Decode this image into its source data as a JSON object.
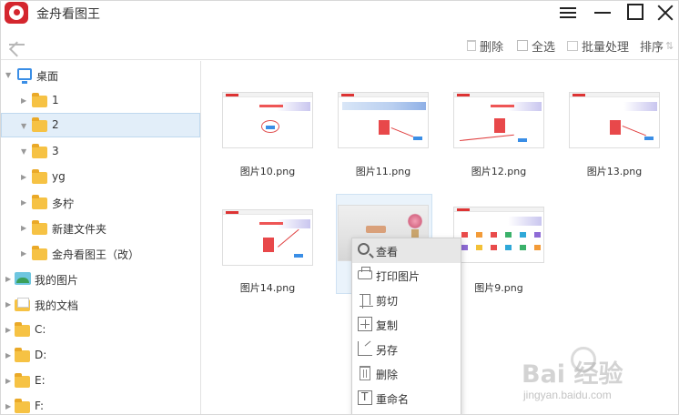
{
  "app": {
    "title": "金舟看图王"
  },
  "toolbar": {
    "delete_label": "删除",
    "select_all_label": "全选",
    "batch_label": "批量处理",
    "sort_label": "排序"
  },
  "sidebar": {
    "items": [
      {
        "label": "桌面",
        "icon": "desktop-icon"
      },
      {
        "label": "1",
        "icon": "folder-icon"
      },
      {
        "label": "2",
        "icon": "folder-icon",
        "selected": true
      },
      {
        "label": "3",
        "icon": "folder-icon"
      },
      {
        "label": "yg",
        "icon": "folder-icon"
      },
      {
        "label": "多柠",
        "icon": "folder-icon"
      },
      {
        "label": "新建文件夹",
        "icon": "folder-icon"
      },
      {
        "label": "金舟看图王（改）",
        "icon": "folder-icon"
      },
      {
        "label": "我的图片",
        "icon": "pictures-icon"
      },
      {
        "label": "我的文档",
        "icon": "documents-icon"
      },
      {
        "label": "C:",
        "icon": "drive-icon"
      },
      {
        "label": "D:",
        "icon": "drive-icon"
      },
      {
        "label": "E:",
        "icon": "drive-icon"
      },
      {
        "label": "F:",
        "icon": "drive-icon"
      }
    ]
  },
  "files": [
    {
      "name": "图片10.png"
    },
    {
      "name": "图片11.png"
    },
    {
      "name": "图片12.png"
    },
    {
      "name": "图片13.png"
    },
    {
      "name": "图片14.png"
    },
    {
      "name": ""
    },
    {
      "name": "图片9.png"
    }
  ],
  "context_menu": {
    "items": [
      {
        "label": "查看",
        "icon": "view-icon"
      },
      {
        "label": "打印图片",
        "icon": "print-icon"
      },
      {
        "label": "剪切",
        "icon": "cut-icon"
      },
      {
        "label": "复制",
        "icon": "copy-icon"
      },
      {
        "label": "另存",
        "icon": "save-as-icon"
      },
      {
        "label": "删除",
        "icon": "delete-icon"
      },
      {
        "label": "重命名",
        "icon": "rename-icon"
      }
    ]
  },
  "watermark": {
    "brand": "Bai 经验",
    "url": "jingyan.baidu.com"
  },
  "colors": {
    "brand_red": "#d4262e",
    "selection": "#e2eef9",
    "folder": "#f6c244"
  }
}
